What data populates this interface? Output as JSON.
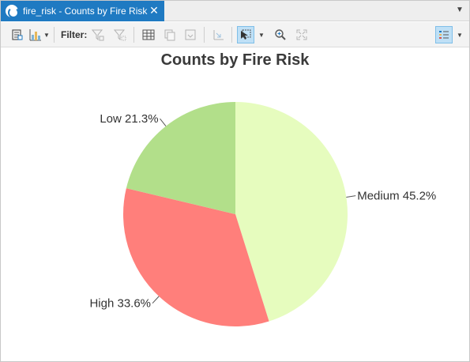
{
  "tab": {
    "title": "fire_risk - Counts by Fire Risk",
    "close_icon": "close-icon"
  },
  "toolbar": {
    "filter_label": "Filter:",
    "icons": [
      "chart-properties-icon",
      "add-chart-icon",
      "filter-selection-icon",
      "filter-extent-icon",
      "table-icon",
      "copy-icon",
      "export-icon",
      "undo-zoom-icon",
      "select-icon",
      "zoom-icon",
      "full-extent-icon",
      "legend-icon"
    ]
  },
  "chart_data": {
    "type": "pie",
    "title": "Counts by Fire Risk",
    "slices": [
      {
        "label": "Medium",
        "percent": 45.2,
        "display": "Medium 45.2%",
        "color": "#e6fcbe"
      },
      {
        "label": "High",
        "percent": 33.6,
        "display": "High 33.6%",
        "color": "#ff7f7b"
      },
      {
        "label": "Low",
        "percent": 21.3,
        "display": "Low 21.3%",
        "color": "#b2df8a"
      }
    ],
    "start": "12 o'clock",
    "direction": "clockwise",
    "legend": "none"
  }
}
